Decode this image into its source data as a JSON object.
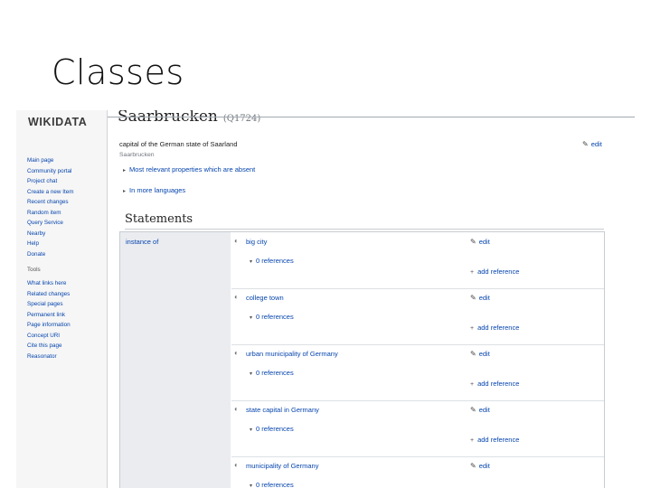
{
  "slide": {
    "title": "Classes"
  },
  "sidebar": {
    "logo": "WIKIDATA",
    "nav": [
      "Main page",
      "Community portal",
      "Project chat",
      "Create a new Item",
      "Recent changes",
      "Random item",
      "Query Service",
      "Nearby",
      "Help",
      "Donate"
    ],
    "tools_heading": "Tools",
    "tools": [
      "What links here",
      "Related changes",
      "Special pages",
      "Permanent link",
      "Page information",
      "Concept URI",
      "Cite this page",
      "Reasonator"
    ]
  },
  "item": {
    "title": "Saarbrucken",
    "qid": "(Q1724)",
    "description": "capital of the German state of Saarland",
    "alias": "Saarbrucken",
    "edit_label": "edit",
    "toggle1": "Most relevant properties which are absent",
    "toggle2": "In more languages"
  },
  "statements": {
    "heading": "Statements",
    "property": "instance of",
    "edit_label": "edit",
    "add_reference_label": "add reference",
    "values": [
      {
        "label": "big city",
        "refs": "0 references"
      },
      {
        "label": "college town",
        "refs": "0 references"
      },
      {
        "label": "urban municipality of Germany",
        "refs": "0 references"
      },
      {
        "label": "state capital in Germany",
        "refs": "0 references"
      },
      {
        "label": "municipality of Germany",
        "refs": "0 references"
      }
    ]
  },
  "icons": {
    "edit": "pencil-icon",
    "rank": "normal-rank-icon",
    "add": "plus-icon",
    "expand": "triangle-right-icon",
    "collapse": "triangle-down-icon"
  }
}
